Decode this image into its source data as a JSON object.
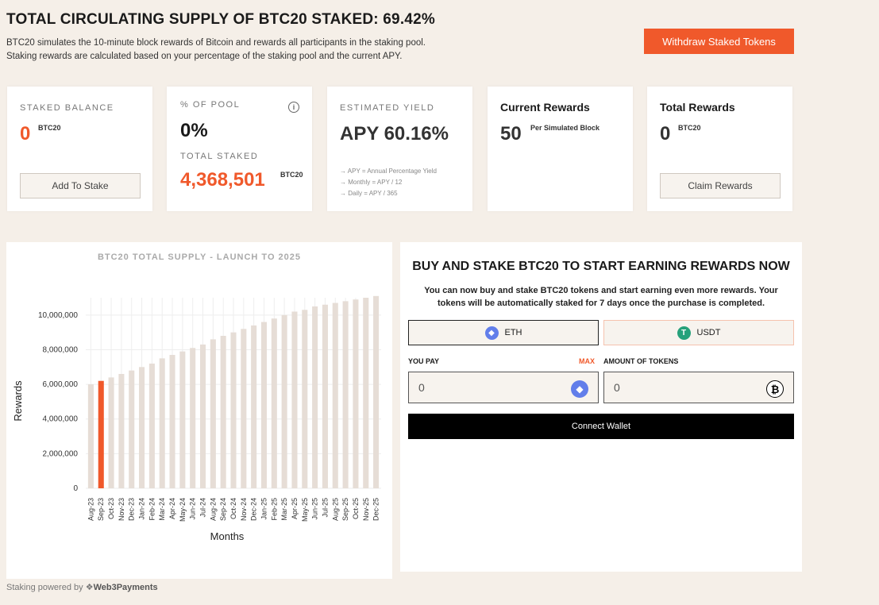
{
  "header": {
    "title": "TOTAL CIRCULATING SUPPLY OF BTC20 STAKED: 69.42%",
    "desc_line1": "BTC20 simulates the 10-minute block rewards of Bitcoin and rewards all participants in the staking pool.",
    "desc_line2": "Staking rewards are calculated based on your percentage of the staking pool and the current APY.",
    "withdraw_label": "Withdraw Staked Tokens"
  },
  "cards": {
    "staked": {
      "label": "STAKED BALANCE",
      "value": "0",
      "unit": "BTC20",
      "button": "Add To Stake"
    },
    "pool": {
      "label": "% OF POOL",
      "value": "0%",
      "total_label": "TOTAL STAKED",
      "total_value": "4,368,501",
      "unit": "BTC20",
      "info": "i"
    },
    "yield": {
      "label": "ESTIMATED YIELD",
      "value": "APY 60.16%",
      "notes": [
        "APY = Annual Percentage Yield",
        "Monthly = APY / 12",
        "Daily = APY / 365"
      ]
    },
    "current": {
      "label": "Current Rewards",
      "value": "50",
      "unit": "Per Simulated Block"
    },
    "total": {
      "label": "Total Rewards",
      "value": "0",
      "unit": "BTC20",
      "button": "Claim Rewards"
    }
  },
  "colors": {
    "accent": "#f0592b",
    "bar": "#e6ddd6",
    "bar_highlight": "#f0592b",
    "eth": "#627eea",
    "usdt": "#26a17b"
  },
  "chart_data": {
    "type": "bar",
    "title": "BTC20 TOTAL SUPPLY - LAUNCH TO 2025",
    "xlabel": "Months",
    "ylabel": "Rewards",
    "ylim": [
      0,
      11000000
    ],
    "yticks": [
      0,
      2000000,
      4000000,
      6000000,
      8000000,
      10000000
    ],
    "ytick_labels": [
      "0",
      "2,000,000",
      "4,000,000",
      "6,000,000",
      "8,000,000",
      "10,000,000"
    ],
    "grid": true,
    "highlight_index": 1,
    "categories": [
      "Aug-23",
      "Sep-23",
      "Oct-23",
      "Nov-23",
      "Dec-23",
      "Jan-24",
      "Feb-24",
      "Mar-24",
      "Apr-24",
      "May-24",
      "Jun-24",
      "Jul-24",
      "Aug-24",
      "Sep-24",
      "Oct-24",
      "Nov-24",
      "Dec-24",
      "Jan-25",
      "Feb-25",
      "Mar-25",
      "Apr-25",
      "May-25",
      "Jun-25",
      "Jul-25",
      "Aug-25",
      "Sep-25",
      "Oct-25",
      "Nov-25",
      "Dec-25"
    ],
    "values": [
      6000000,
      6200000,
      6400000,
      6600000,
      6800000,
      7000000,
      7200000,
      7500000,
      7700000,
      7900000,
      8100000,
      8300000,
      8600000,
      8800000,
      9000000,
      9200000,
      9400000,
      9600000,
      9800000,
      10000000,
      10200000,
      10300000,
      10500000,
      10600000,
      10700000,
      10800000,
      10900000,
      11000000,
      11100000
    ]
  },
  "buy": {
    "title": "BUY AND STAKE BTC20 TO START EARNING REWARDS NOW",
    "desc_line1": "You can now buy and stake BTC20 tokens and start earning even more rewards. Your",
    "desc_line2": "tokens will be automatically staked for 7 days once the purchase is completed.",
    "tab_eth": "ETH",
    "tab_usdt": "USDT",
    "you_pay_label": "YOU PAY",
    "max_label": "MAX",
    "amount_label": "AMOUNT OF TOKENS",
    "pay_value": "0",
    "amount_value": "0",
    "connect_label": "Connect Wallet"
  },
  "footer": {
    "prefix": "Staking powered by",
    "brand": "Web3Payments"
  }
}
